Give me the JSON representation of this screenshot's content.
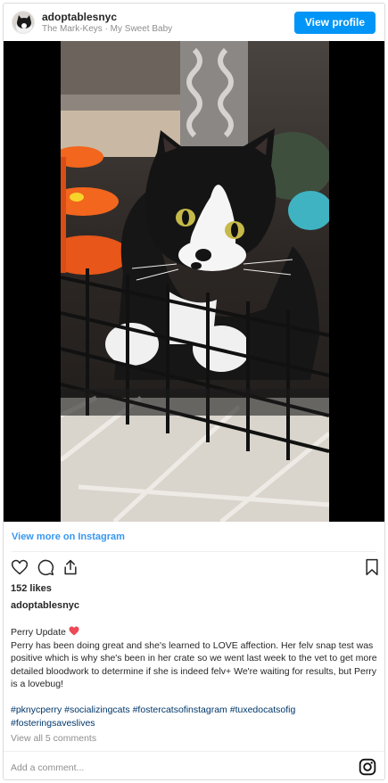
{
  "header": {
    "username": "adoptablesnyc",
    "subtitle": "The Mark-Keys · My Sweet Baby",
    "view_profile_label": "View profile"
  },
  "media": {
    "icon": "cat-photo"
  },
  "view_more_label": "View more on Instagram",
  "actions": {
    "like_icon": "heart-icon",
    "comment_icon": "comment-icon",
    "share_icon": "share-icon",
    "save_icon": "bookmark-icon"
  },
  "likes_label": "152 likes",
  "owner_username": "adoptablesnyc",
  "caption": {
    "title": "Perry Update",
    "body": "Perry has been doing great and she's learned to LOVE affection. Her felv snap test was positive which is why she's been in her crate so we went last week to the vet to get more detailed bloodwork to determine if she is indeed felv+ We're waiting for results, but Perry is a lovebug!"
  },
  "hashtags": [
    "#pknycperry",
    "#socializingcats",
    "#fostercatsofinstagram",
    "#tuxedocatsofig",
    "#fosteringsaveslives"
  ],
  "view_comments_label": "View all 5 comments",
  "comment_placeholder": "Add a comment...",
  "colors": {
    "accent": "#0095f6",
    "link": "#3897f0",
    "hashtag": "#00376b",
    "heart": "#ed4956"
  }
}
